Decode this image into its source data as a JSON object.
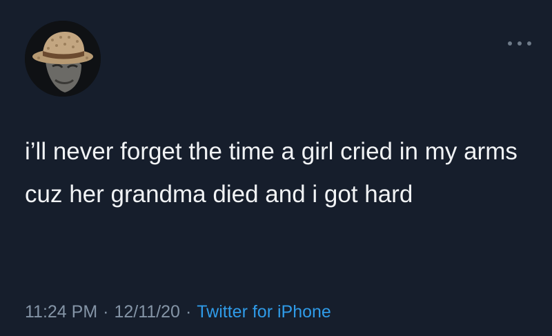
{
  "tweet": {
    "avatar_icon": "user-avatar-icon",
    "more_icon": "more-options-icon",
    "text": "i’ll never forget the time a girl cried in my arms cuz her grandma died and i got hard",
    "time": "11:24 PM",
    "separator": "·",
    "date": "12/11/20",
    "source": "Twitter for iPhone"
  },
  "colors": {
    "background": "#161e2c",
    "text": "#f1f3f5",
    "meta": "#8494a6",
    "link": "#2f9be8"
  }
}
